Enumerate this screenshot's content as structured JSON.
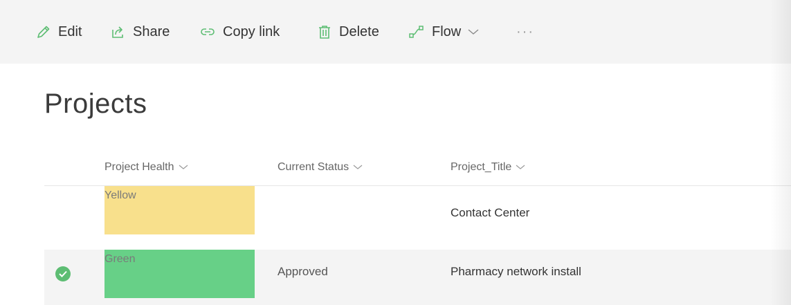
{
  "toolbar": {
    "edit_label": "Edit",
    "share_label": "Share",
    "copy_link_label": "Copy link",
    "delete_label": "Delete",
    "flow_label": "Flow",
    "more_label": "···",
    "icon_color": "#5dbd73"
  },
  "list": {
    "title": "Projects",
    "columns": [
      {
        "label": "Project Health"
      },
      {
        "label": "Current Status"
      },
      {
        "label": "Project_Title"
      }
    ],
    "rows": [
      {
        "health": "Yellow",
        "health_color": "#f8e08c",
        "status": "",
        "title": "Contact Center",
        "selected": false
      },
      {
        "health": "Green",
        "health_color": "#67d087",
        "status": "Approved",
        "title": "Pharmacy network install",
        "selected": true
      }
    ]
  }
}
